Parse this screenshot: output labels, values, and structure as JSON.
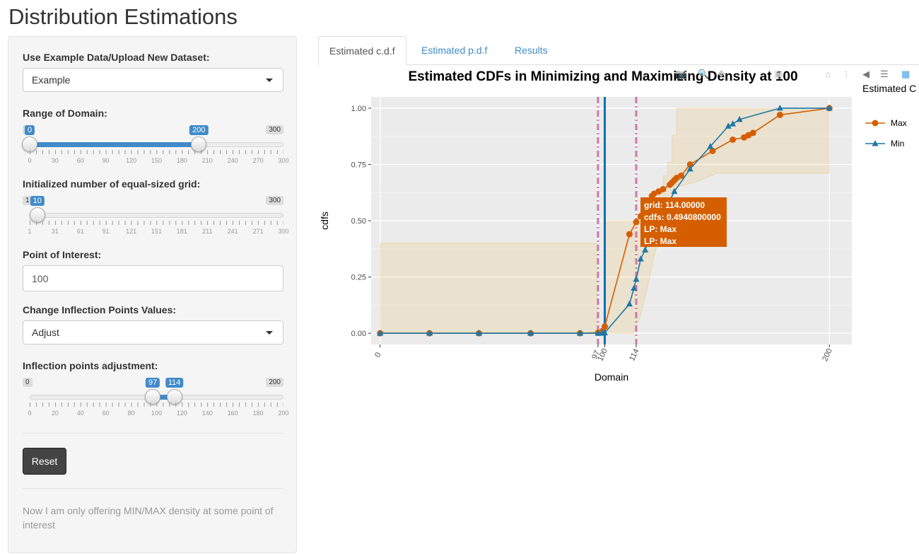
{
  "app_title": "Distribution Estimations",
  "sidebar": {
    "dataset_label": "Use Example Data/Upload New Dataset:",
    "dataset_value": "Example",
    "domain_label": "Range of Domain:",
    "domain_slider": {
      "min": 0,
      "max": 300,
      "from": 0,
      "to": 200,
      "ticks": [
        "0",
        "30",
        "60",
        "90",
        "120",
        "150",
        "180",
        "210",
        "240",
        "270",
        "300"
      ]
    },
    "grid_label": "Initialized number of equal-sized grid:",
    "grid_slider": {
      "min": 1,
      "max": 300,
      "value": 10,
      "ticks": [
        "1",
        "31",
        "61",
        "91",
        "121",
        "151",
        "181",
        "211",
        "241",
        "271",
        "300"
      ]
    },
    "poi_label": "Point of Interest:",
    "poi_value": "100",
    "inflection_label": "Change Inflection Points Values:",
    "inflection_value": "Adjust",
    "adjust_label": "Inflection points adjustment:",
    "adjust_slider": {
      "min": 0,
      "max": 200,
      "from": 97,
      "to": 114,
      "ticks": [
        "0",
        "20",
        "40",
        "60",
        "80",
        "100",
        "120",
        "140",
        "160",
        "180",
        "200"
      ]
    },
    "reset_label": "Reset",
    "footnote": "Now I am only offering MIN/MAX density at some point of interest"
  },
  "tabs": [
    {
      "label": "Estimated c.d.f",
      "active": true
    },
    {
      "label": "Estimated p.d.f",
      "active": false
    },
    {
      "label": "Results",
      "active": false
    }
  ],
  "tooltip": {
    "line1": "grid: 114.00000",
    "line2": "cdfs: 0.4940800000",
    "line3": "LP: Max",
    "line4": "LP: Max"
  },
  "chart_data": {
    "type": "line",
    "title": "Estimated CDFs in Minimizing and Maximizing Density at 100",
    "xlabel": "Domain",
    "ylabel": "cdfs",
    "legend_title": "Estimated C",
    "legend_position": "right",
    "xlim": [
      -4,
      210
    ],
    "ylim": [
      -0.05,
      1.05
    ],
    "x_ticks": [
      "0",
      "97",
      "100",
      "114",
      "200"
    ],
    "y_ticks": [
      "0.00",
      "0.25",
      "0.50",
      "0.75",
      "1.00"
    ],
    "vlines": [
      {
        "x": 97,
        "style": "dashdot",
        "color": "#cc79a7"
      },
      {
        "x": 100,
        "style": "solid",
        "color": "#0072b2"
      },
      {
        "x": 114,
        "style": "dashdot",
        "color": "#cc79a7"
      }
    ],
    "band_color": "#e69f00",
    "series": [
      {
        "name": "Max",
        "color": "#d55e00",
        "marker": "circle",
        "x": [
          0,
          22,
          44,
          67,
          89,
          97,
          99,
          100,
          111,
          114,
          116,
          119,
          120,
          121,
          122,
          124,
          126,
          129,
          130,
          131,
          132,
          134,
          138,
          148,
          157,
          162,
          164,
          166,
          178,
          200
        ],
        "y": [
          0,
          0,
          0,
          0,
          0,
          0.002,
          0.01,
          0.03,
          0.44,
          0.494,
          0.52,
          0.56,
          0.59,
          0.61,
          0.62,
          0.63,
          0.64,
          0.66,
          0.67,
          0.68,
          0.69,
          0.7,
          0.75,
          0.81,
          0.86,
          0.87,
          0.88,
          0.89,
          0.97,
          1.0
        ]
      },
      {
        "name": "Min",
        "color": "#1f77a4",
        "marker": "triangle",
        "x": [
          0,
          22,
          44,
          67,
          89,
          97,
          99,
          100,
          111,
          113,
          114,
          116,
          118,
          119,
          121,
          123,
          126,
          128,
          131,
          138,
          147,
          155,
          157,
          160,
          178,
          200
        ],
        "y": [
          0,
          0,
          0,
          0,
          0,
          0,
          0,
          0.002,
          0.13,
          0.2,
          0.24,
          0.33,
          0.37,
          0.4,
          0.43,
          0.47,
          0.52,
          0.57,
          0.63,
          0.73,
          0.83,
          0.92,
          0.93,
          0.95,
          1.0,
          1.0
        ]
      }
    ]
  }
}
